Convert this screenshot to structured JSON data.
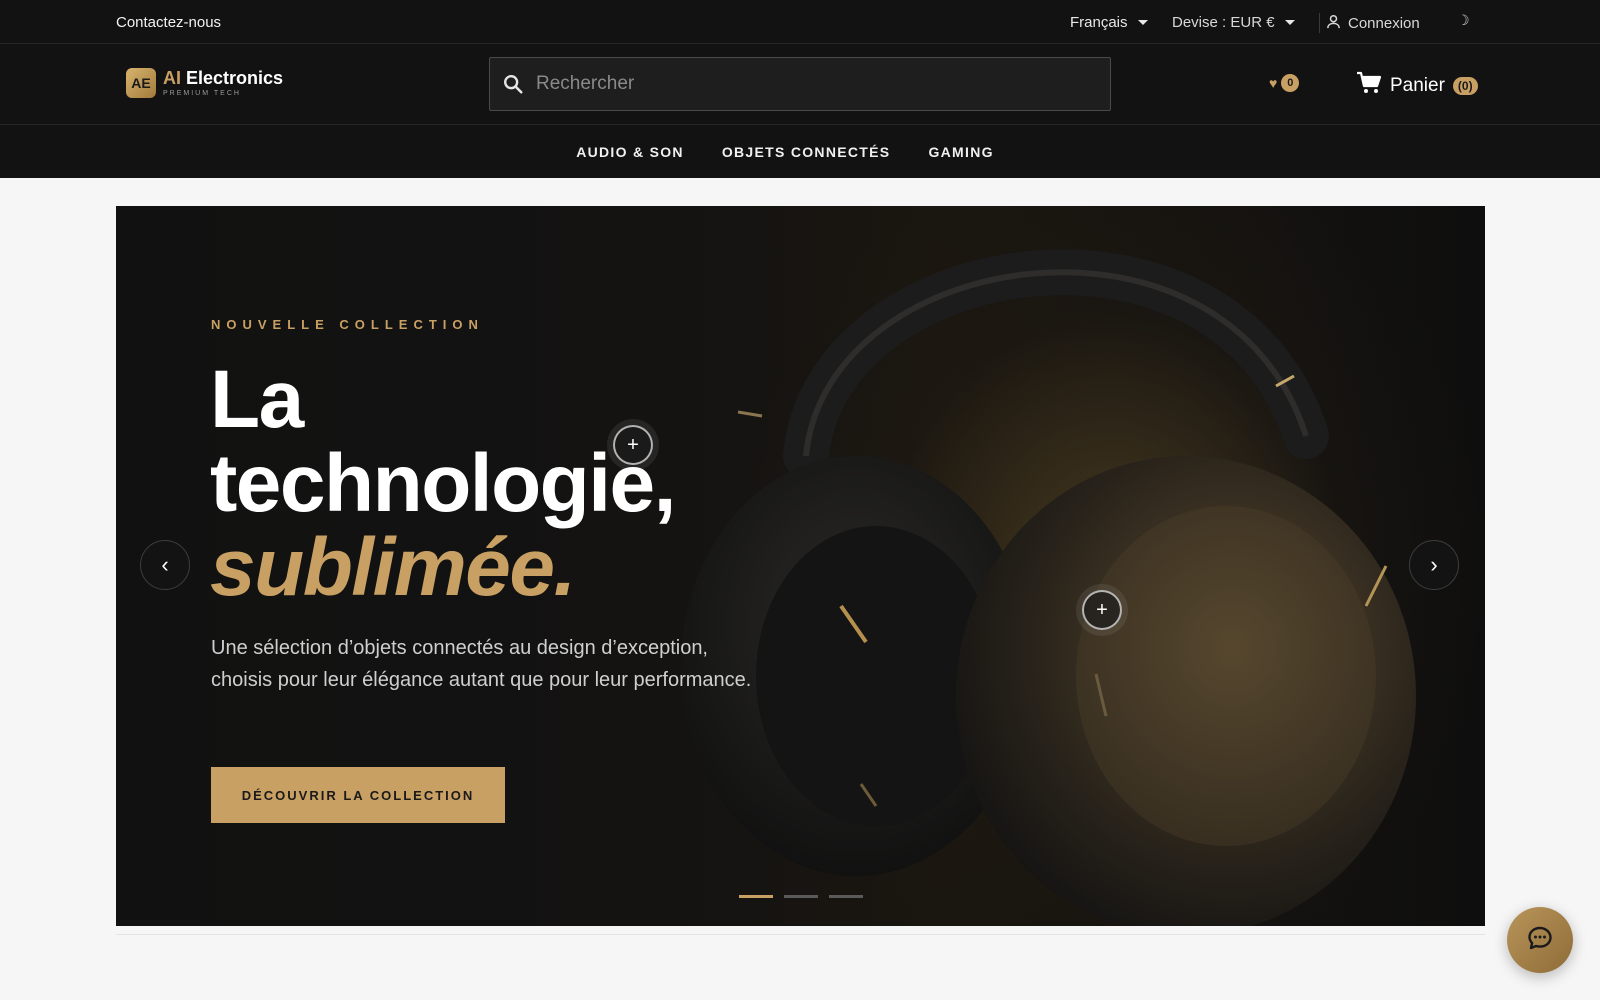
{
  "topbar": {
    "contact": "Contactez-nous",
    "language": "Français",
    "currency": "Devise : EUR €",
    "login": "Connexion",
    "theme_icon": "moon-icon"
  },
  "header": {
    "logo_badge": "AE",
    "logo_name_prefix": "AI",
    "logo_name": "Electronics",
    "logo_tagline": "PREMIUM TECH",
    "search_placeholder": "Rechercher",
    "wishlist_count": "0",
    "cart_label": "Panier",
    "cart_count": "(0)"
  },
  "nav": {
    "items": [
      "AUDIO & SON",
      "OBJETS CONNECTÉS",
      "GAMING"
    ]
  },
  "hero": {
    "eyebrow": "NOUVELLE COLLECTION",
    "headline_line1": "La",
    "headline_line2": "technologie,",
    "headline_accent": "sublimée.",
    "description": "Une sélection d’objets connectés au design d’exception, choisis pour leur élégance autant que pour leur performance.",
    "cta_label": "DÉCOUVRIR LA COLLECTION",
    "prev_symbol": "‹",
    "next_symbol": "›",
    "hotspot_symbol": "+",
    "slides_total": 3,
    "active_slide": 1
  },
  "colors": {
    "accent": "#c9a063",
    "dark": "#121212"
  }
}
